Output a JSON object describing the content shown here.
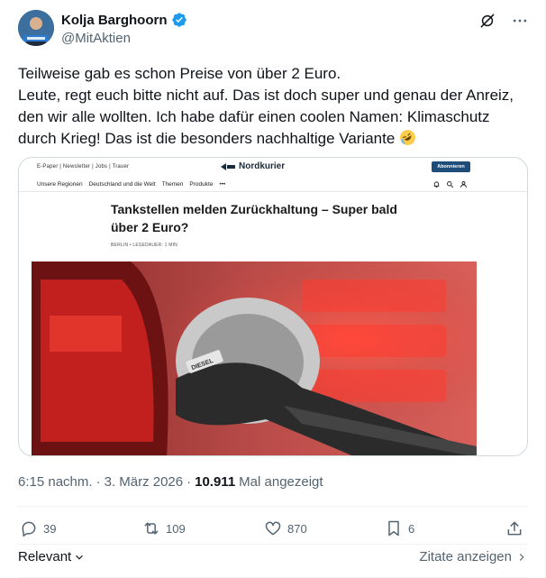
{
  "author": {
    "name": "Kolja Barghoorn",
    "handle": "@MitAktien"
  },
  "tweet": {
    "text": "Teilweise gab es schon Preise von über 2 Euro.\nLeute, regt euch bitte nicht auf. Das ist doch super und genau der Anreiz, den wir alle wollten. Ich habe dafür einen coolen Namen: Klimaschutz durch Krieg! Das ist die besonders nachhaltige Variante",
    "emoji": "rolling-on-floor-laughing-emoji"
  },
  "card": {
    "top_links": "E-Paper  |  Newsletter  |  Jobs  |  Trauer",
    "site_name": "Nordkurier",
    "subscribe_label": "Abonnieren",
    "nav_items": [
      "Unsere Regionen",
      "Deutschland und die Welt",
      "Themen",
      "Produkte",
      "•••"
    ],
    "headline": "Tankstellen melden Zurückhaltung – Super bald über 2 Euro?",
    "dateline": "BERLIN • LESEDAUER: 1 MIN",
    "photo_nozzle_label": "DIESEL"
  },
  "meta": {
    "time": "6:15 nachm.",
    "separator": "·",
    "date": "3. März 2026",
    "views_count": "10.911",
    "views_label": "Mal angezeigt"
  },
  "actions": {
    "replies": "39",
    "reposts": "109",
    "likes": "870",
    "bookmarks": "6"
  },
  "footer": {
    "sort_label": "Relevant",
    "quotes_label": "Zitate anzeigen"
  },
  "colors": {
    "verified_blue": "#1d9bf0",
    "secondary_text": "#536471",
    "border": "#cfd9de"
  }
}
